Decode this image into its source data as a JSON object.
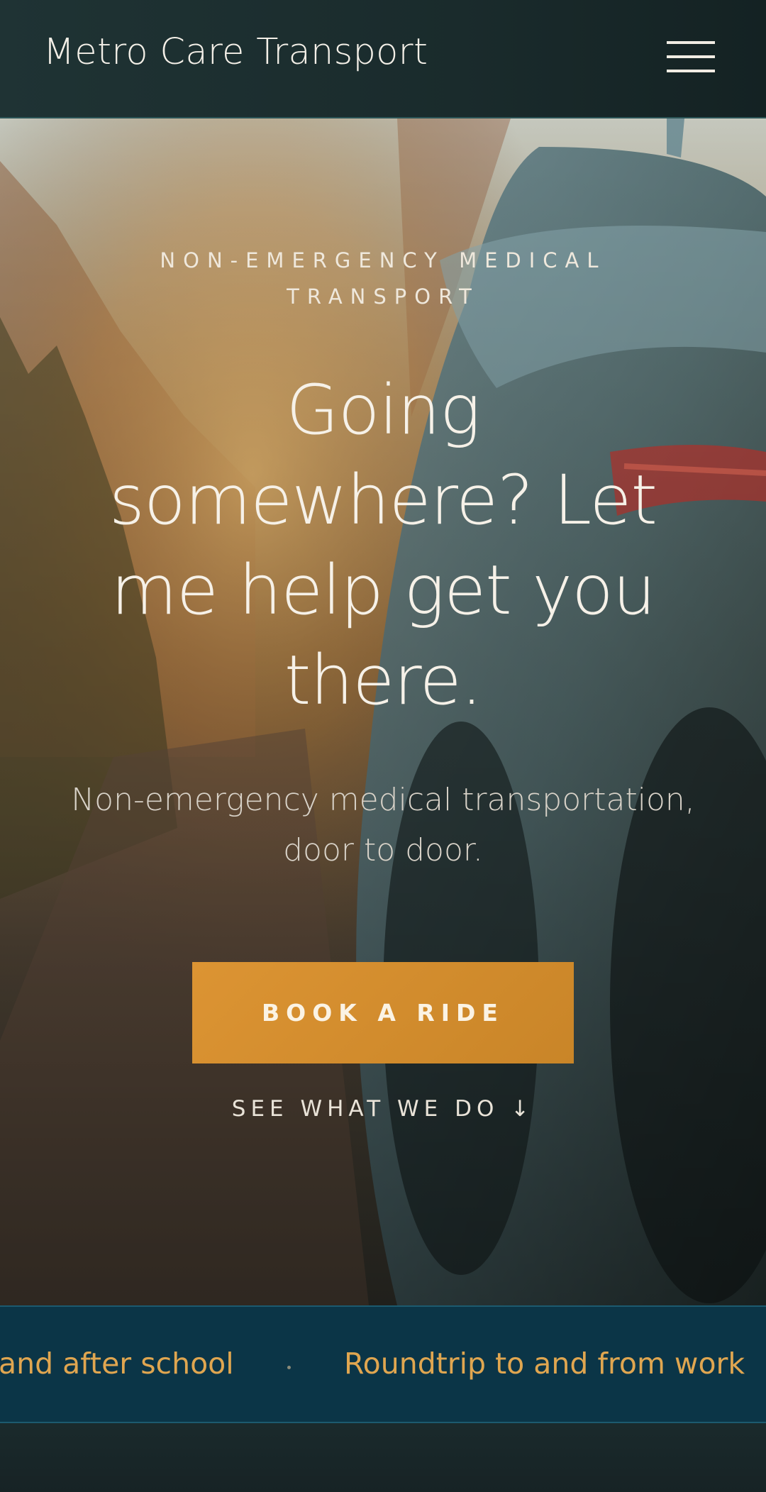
{
  "header": {
    "brand": "Metro Care Transport",
    "menu_icon": "hamburger-menu-icon"
  },
  "hero": {
    "eyebrow_line1": "NON-EMERGENCY MEDICAL",
    "eyebrow_line2": "TRANSPORT",
    "headline_line1": "Going",
    "headline_line2": "somewhere? Let",
    "headline_line3": "me help get you",
    "headline_line4": "there.",
    "subhead_line1": "Non-emergency medical transportation,",
    "subhead_line2": "door to door.",
    "cta_label": "BOOK A RIDE",
    "secondary_link": "SEE WHAT WE DO ↓"
  },
  "marquee": {
    "items": [
      "and after school",
      "Roundtrip to and from work"
    ]
  },
  "colors": {
    "header_bg": "#1f3334",
    "accent": "#d8912f",
    "marquee_bg": "#0b3547",
    "marquee_text": "#e0a650"
  }
}
